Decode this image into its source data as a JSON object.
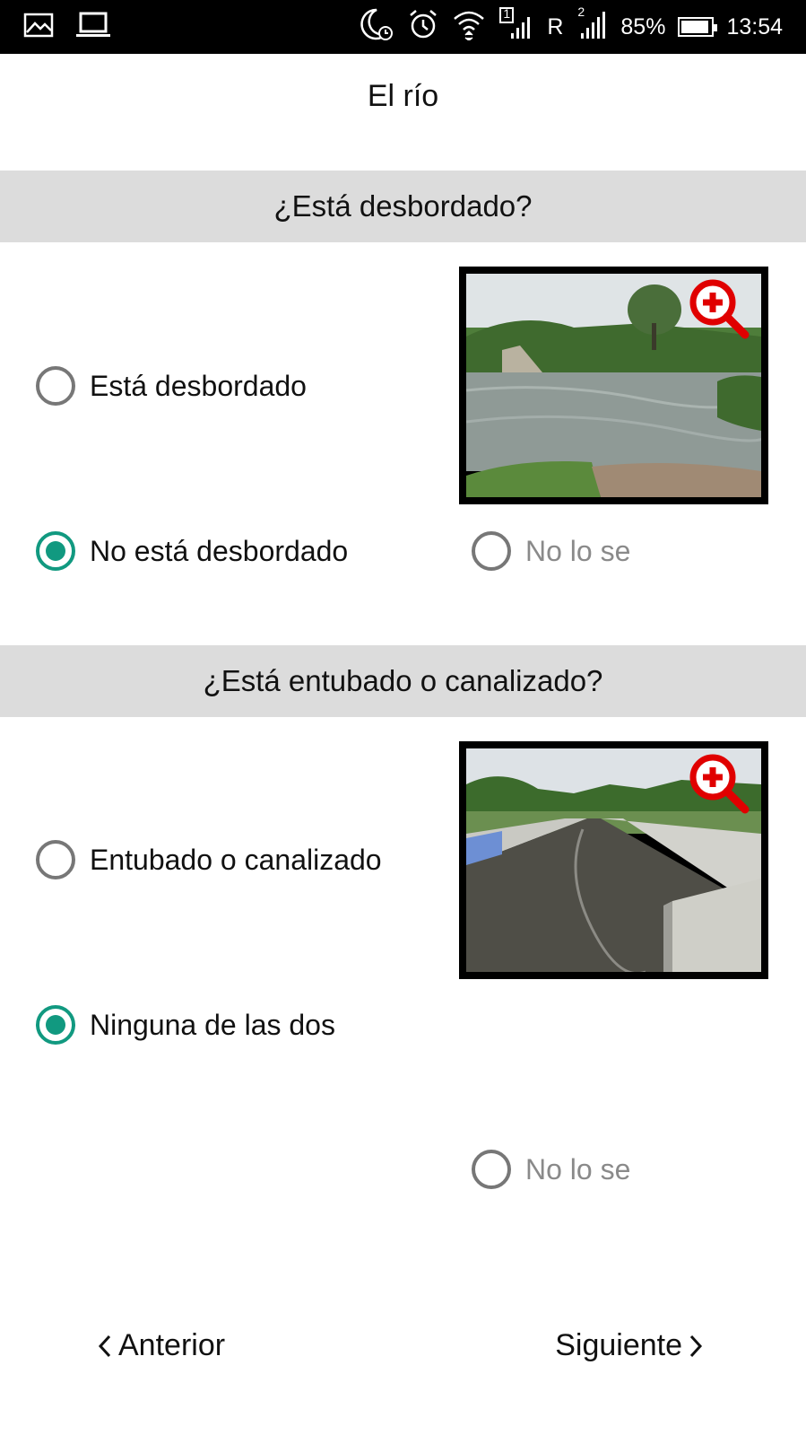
{
  "status_bar": {
    "battery_percent": "85%",
    "time": "13:54",
    "network_letter": "R",
    "sim1": "1",
    "sim2": "2"
  },
  "page": {
    "title": "El río"
  },
  "sections": [
    {
      "question": "¿Está desbordado?",
      "options": [
        {
          "label": "Está desbordado",
          "checked": false
        },
        {
          "label": "No está desbordado",
          "checked": true
        },
        {
          "label": "No lo se",
          "checked": false
        }
      ],
      "image_description": "flooded river photo with zoom icon"
    },
    {
      "question": "¿Está entubado o canalizado?",
      "options": [
        {
          "label": "Entubado o canalizado",
          "checked": false
        },
        {
          "label": "Ninguna de las dos",
          "checked": true
        },
        {
          "label": "No lo se",
          "checked": false
        }
      ],
      "image_description": "channelized river photo with zoom icon"
    }
  ],
  "navigation": {
    "prev_label": "Anterior",
    "next_label": "Siguiente"
  },
  "colors": {
    "accent": "#119980",
    "header_bg": "#dcdcdc",
    "zoom_red": "#e00000"
  }
}
